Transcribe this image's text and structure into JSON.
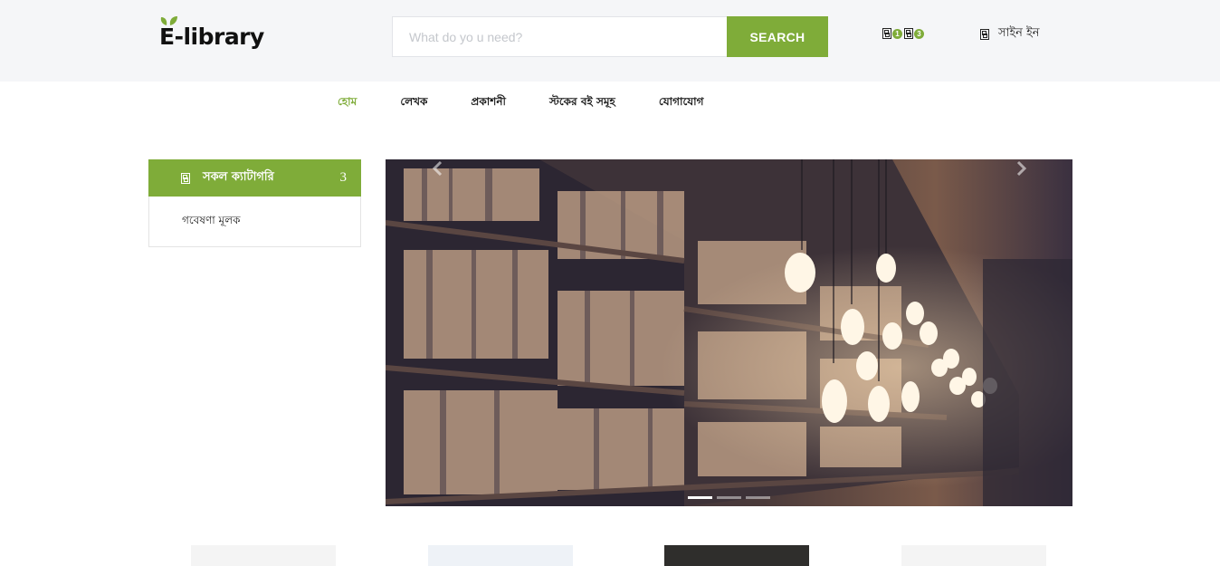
{
  "header": {
    "logo_text": "E-library",
    "search": {
      "placeholder": "What do yo u need?",
      "button_label": "SEARCH"
    },
    "cart": {
      "wishlist_count": "1",
      "cart_count": "3"
    },
    "signin_label": "সাইন ইন"
  },
  "nav": {
    "items": [
      {
        "label": "হোম",
        "active": true
      },
      {
        "label": "লেখক",
        "active": false
      },
      {
        "label": "প্রকাশনী",
        "active": false
      },
      {
        "label": "স্টকের বই সমূহ",
        "active": false
      },
      {
        "label": "যোগাযোগ",
        "active": false
      }
    ]
  },
  "sidebar": {
    "header_label": "সকল ক্যাটাগরি",
    "count": "3",
    "items": [
      {
        "label": "গবেষণা মূলক"
      }
    ]
  },
  "slider": {
    "slide_count": 3,
    "active_index": 0
  },
  "colors": {
    "accent": "#7fac39",
    "topbar_bg": "#f5f6f8"
  }
}
